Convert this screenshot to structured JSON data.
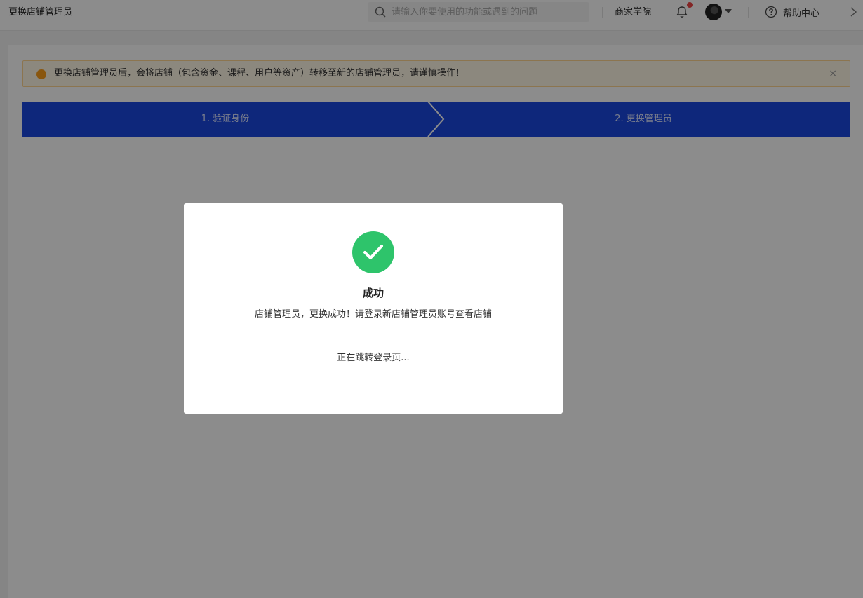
{
  "header": {
    "title": "更换店铺管理员",
    "search_placeholder": "请输入你要使用的功能或遇到的问题",
    "academy": "商家学院",
    "help": "帮助中心"
  },
  "alert": {
    "text": "更换店铺管理员后，会将店铺（包含资金、课程、用户等资产）转移至新的店铺管理员，请谨慎操作！",
    "close": "×"
  },
  "steps": [
    {
      "label": "1. 验证身份"
    },
    {
      "label": "2. 更换管理员"
    }
  ],
  "modal": {
    "title": "成功",
    "message": "店铺管理员，更换成功！请登录新店铺管理员账号查看店铺",
    "redirect": "正在跳转登录页..."
  },
  "colors": {
    "step_bar": "#1b47e0",
    "success": "#2ec46b",
    "alert_bg": "#fff7e6",
    "alert_icon": "#fa9d1a",
    "badge": "#ee4444"
  }
}
